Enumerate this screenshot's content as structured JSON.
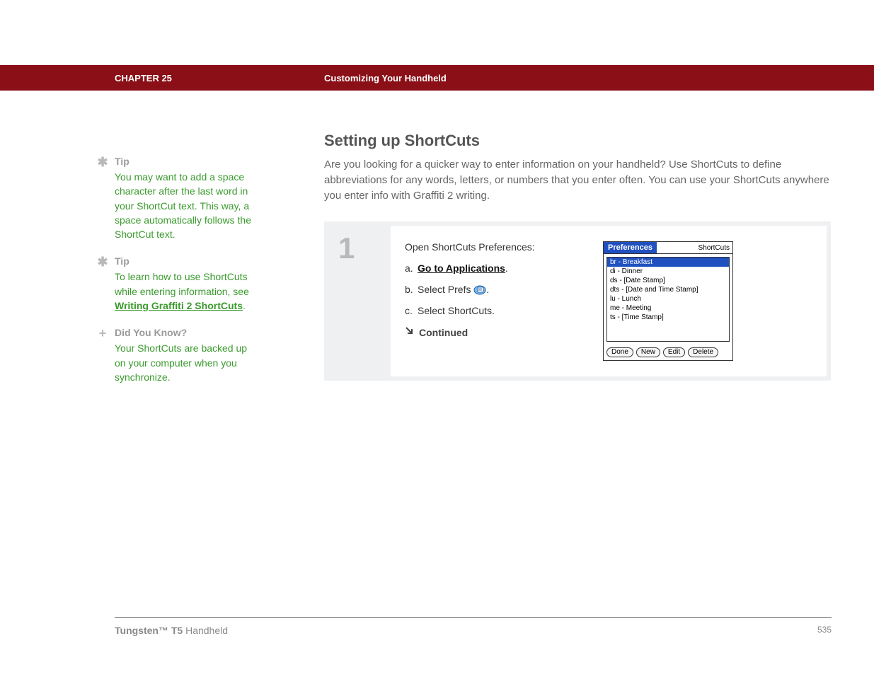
{
  "header": {
    "chapter": "CHAPTER 25",
    "title": "Customizing Your Handheld"
  },
  "sidebar": {
    "items": [
      {
        "icon": "✱",
        "heading": "Tip",
        "body": "You may want to add a space character after the last word in your ShortCut text. This way, a space automatically follows the ShortCut text."
      },
      {
        "icon": "✱",
        "heading": "Tip",
        "body_prefix": "To learn how to use ShortCuts while entering information, see ",
        "link": "Writing Graffiti 2 ShortCuts",
        "body_suffix": "."
      },
      {
        "icon": "+",
        "heading": "Did You Know?",
        "body": "Your ShortCuts are backed up on your computer when you synchronize."
      }
    ]
  },
  "main": {
    "section_title": "Setting up ShortCuts",
    "intro": "Are you looking for a quicker way to enter information on your handheld? Use ShortCuts to define abbreviations for any words, letters, or numbers that you enter often. You can use your ShortCuts anywhere you enter info with Graffiti 2 writing.",
    "step": {
      "number": "1",
      "lead": "Open ShortCuts Preferences:",
      "subs": {
        "a": {
          "letter": "a.",
          "link": "Go to Applications",
          "suffix": "."
        },
        "b": {
          "letter": "b.",
          "prefix": "Select Prefs ",
          "suffix": "."
        },
        "c": {
          "letter": "c.",
          "text": "Select ShortCuts."
        }
      },
      "continued": "Continued"
    }
  },
  "palm": {
    "title_left": "Preferences",
    "title_right": "ShortCuts",
    "rows": [
      "br - Breakfast",
      "di - Dinner",
      "ds - [Date Stamp]",
      "dts - [Date and Time Stamp]",
      "lu - Lunch",
      "me - Meeting",
      "ts - [Time Stamp]"
    ],
    "buttons": [
      "Done",
      "New",
      "Edit",
      "Delete"
    ]
  },
  "footer": {
    "product_bold": "Tungsten™ T5",
    "product_rest": " Handheld",
    "page": "535"
  }
}
